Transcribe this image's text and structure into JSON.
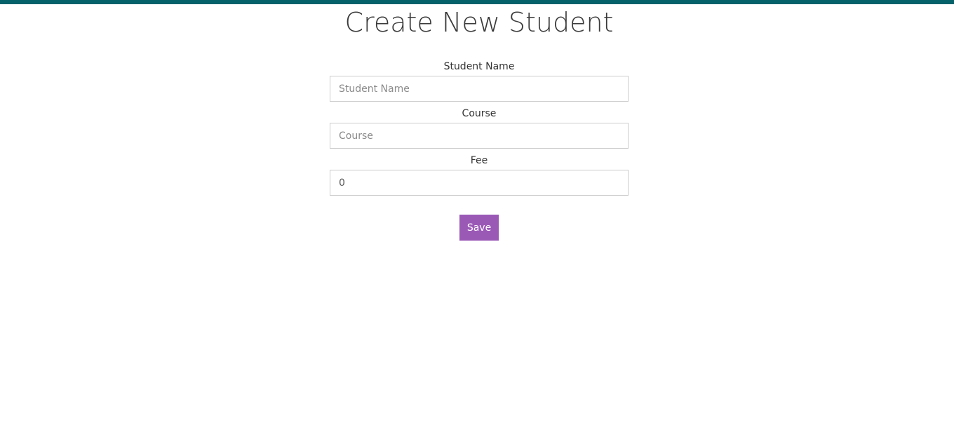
{
  "colors": {
    "top_bar": "#05626b",
    "save_button": "#9b59b6"
  },
  "header": {
    "title": "Create New Student"
  },
  "form": {
    "fields": [
      {
        "label": "Student Name",
        "placeholder": "Student Name",
        "value": ""
      },
      {
        "label": "Course",
        "placeholder": "Course",
        "value": ""
      },
      {
        "label": "Fee",
        "placeholder": "",
        "value": "0"
      }
    ],
    "save_label": "Save"
  }
}
